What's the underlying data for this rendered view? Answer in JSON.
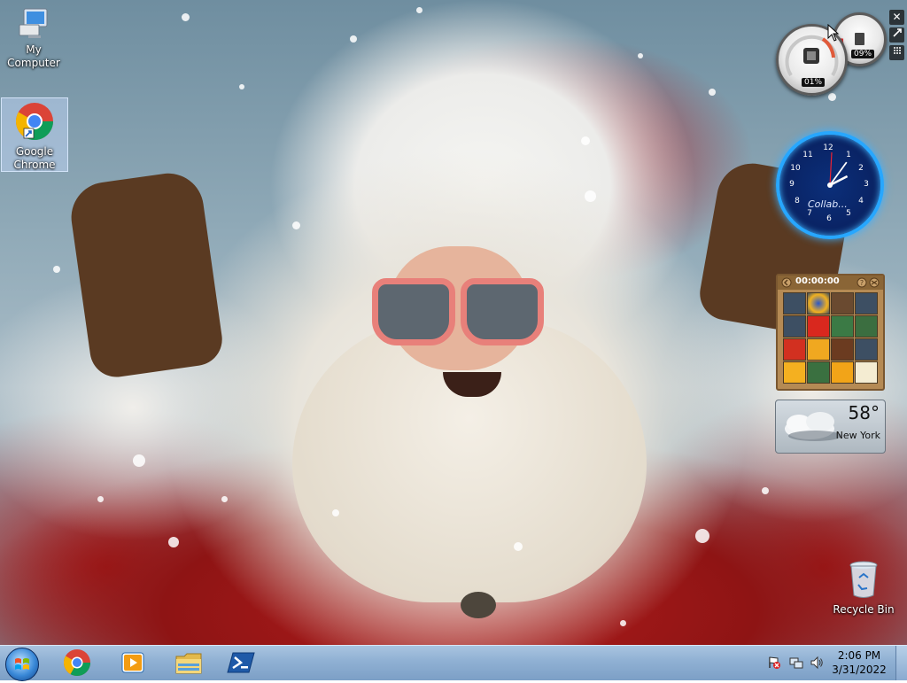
{
  "desktop": {
    "icons": [
      {
        "label": "My Computer",
        "icon": "computer-icon"
      },
      {
        "label": "Google Chrome",
        "icon": "chrome-icon"
      },
      {
        "label": "Recycle Bin",
        "icon": "recycle-bin-icon"
      }
    ]
  },
  "gadgets": {
    "controls": {
      "close": "✕"
    },
    "cpu_meter": {
      "cpu": "01%",
      "memory": "09%",
      "cpu_value": 0.01,
      "memory_value": 0.09
    },
    "clock": {
      "brand": "Collab...",
      "hour": 2,
      "minute": 6
    },
    "puzzle": {
      "timer": "00:00:00"
    },
    "weather": {
      "temperature": "58°",
      "city": "New York"
    }
  },
  "taskbar": {
    "pinned": [
      "chrome-icon",
      "media-player-icon",
      "file-explorer-icon",
      "powershell-icon"
    ],
    "clock": {
      "time": "2:06 PM",
      "date": "3/31/2022"
    }
  },
  "colors": {
    "taskbar": "#8fb0d3",
    "clock_ring": "#27a7ff",
    "weather_bg": "#c2cbd2"
  }
}
